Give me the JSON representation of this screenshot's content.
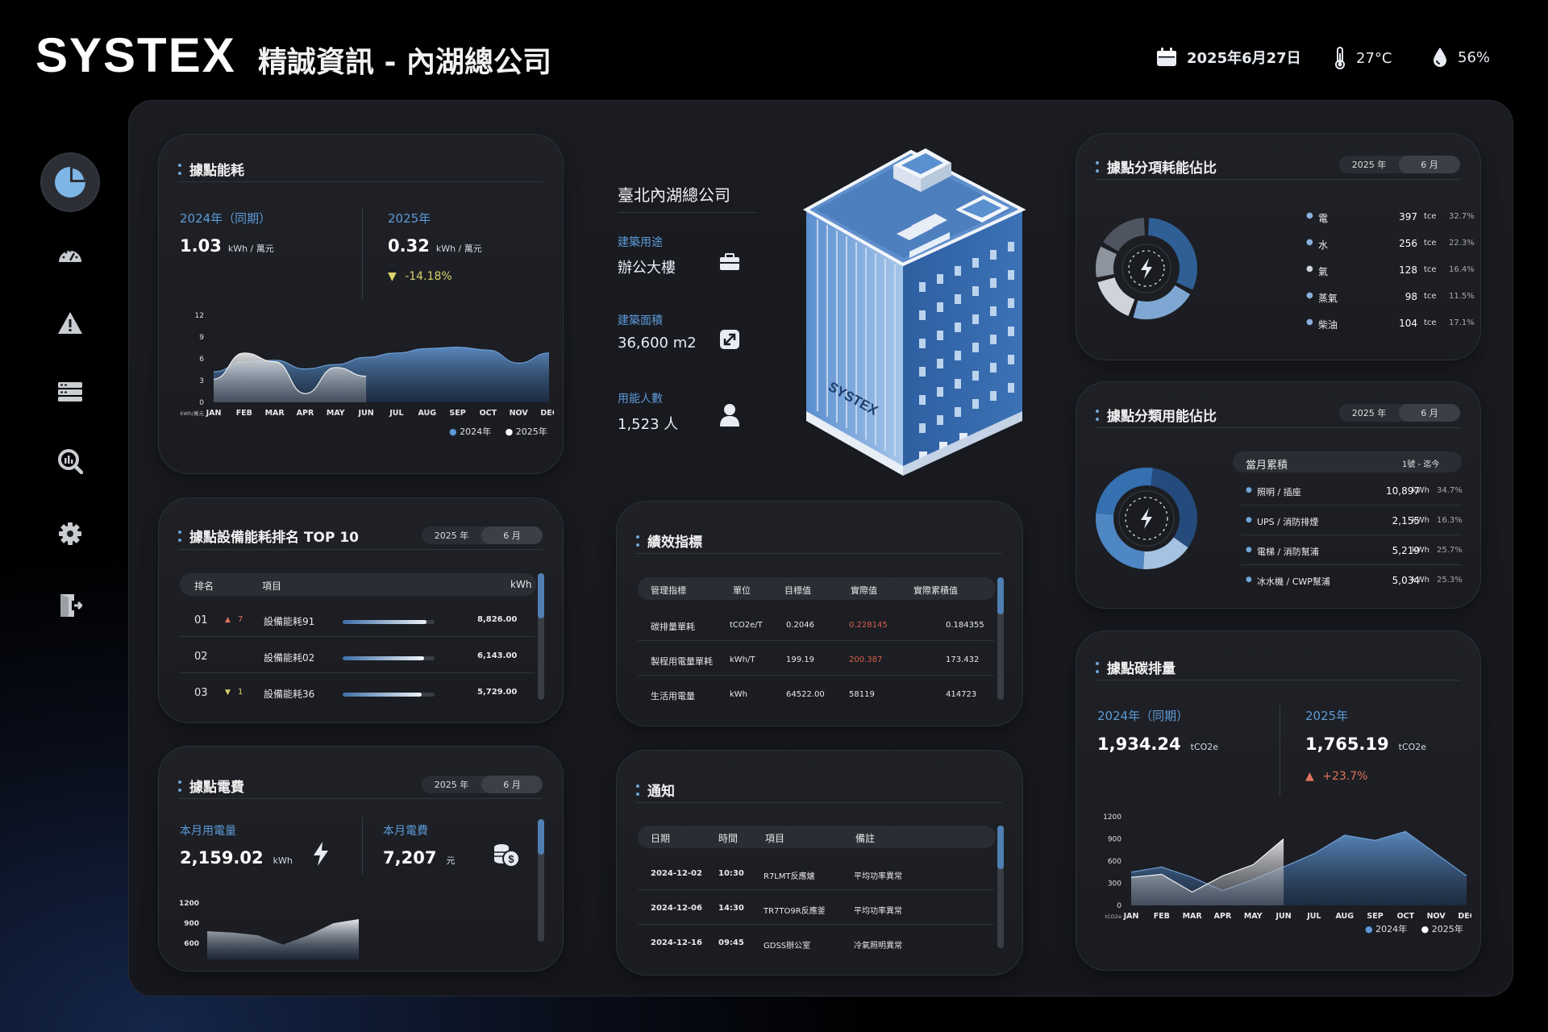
{
  "header": {
    "brand": "SYSTEX",
    "site_title": "精誠資訊 - 內湖總公司",
    "date": "2025年6月27日",
    "temp": "27°C",
    "humidity": "56%"
  },
  "colors": {
    "accent": "#5d9ad6",
    "up_arrow": "#e0735b",
    "down_arrow": "#d9d36a",
    "highlight_red": "#d8604a"
  },
  "sidebar": [
    {
      "icon": "pie-chart-icon",
      "active": true
    },
    {
      "icon": "gauge-icon"
    },
    {
      "icon": "warning-icon"
    },
    {
      "icon": "server-icon"
    },
    {
      "icon": "search-chart-icon"
    },
    {
      "icon": "gear-icon"
    },
    {
      "icon": "logout-icon"
    }
  ],
  "energy": {
    "title": "據點能耗",
    "prev_label": "2024年（同期）",
    "prev_value": "1.03",
    "prev_unit": "kWh / 萬元",
    "cur_label": "2025年",
    "cur_value": "0.32",
    "cur_unit": "kWh / 萬元",
    "change": "-14.18%",
    "y_unit": "kWh/萬元",
    "legend_prev": "2024年",
    "legend_cur": "2025年"
  },
  "energy_chart": {
    "type": "area",
    "x": [
      "JAN",
      "FEB",
      "MAR",
      "APR",
      "MAY",
      "JUN",
      "JUL",
      "AUG",
      "SEP",
      "OCT",
      "NOV",
      "DEC"
    ],
    "ylim": [
      0,
      12
    ],
    "yticks": [
      "12",
      "9",
      "6",
      "3",
      "0"
    ],
    "series": [
      {
        "name": "2024年",
        "values": [
          4.2,
          5.6,
          5.8,
          4.6,
          5.2,
          6.2,
          6.8,
          7.4,
          7.6,
          7.2,
          5.4,
          6.8
        ]
      },
      {
        "name": "2025年",
        "values": [
          3.2,
          6.8,
          5.6,
          1.2,
          4.8,
          3.6
        ]
      }
    ]
  },
  "ranking": {
    "title": "據點設備能耗排名 TOP 10",
    "year": "2025 年",
    "month": "6 月",
    "headers": [
      "排名",
      "項目",
      "kWh"
    ],
    "rows": [
      {
        "rank": "01",
        "trend": "up",
        "delta": "7",
        "item": "設備能耗91",
        "value": "8,826.00",
        "fill": 0.98
      },
      {
        "rank": "02",
        "trend": "",
        "delta": "",
        "item": "設備能耗02",
        "value": "6,143.00",
        "fill": 0.95
      },
      {
        "rank": "03",
        "trend": "down",
        "delta": "1",
        "item": "設備能耗36",
        "value": "5,729.00",
        "fill": 0.92
      }
    ]
  },
  "electricity": {
    "title": "據點電費",
    "year": "2025 年",
    "month": "6 月",
    "usage_label": "本月用電量",
    "usage_value": "2,159.02",
    "usage_unit": "kWh",
    "fee_label": "本月電費",
    "fee_value": "7,207",
    "fee_unit": "元"
  },
  "electricity_chart": {
    "type": "area",
    "yticks": [
      "1200",
      "900",
      "600"
    ],
    "ylim": [
      600,
      1200
    ],
    "values": [
      780,
      760,
      720,
      580,
      720,
      900,
      960
    ]
  },
  "building": {
    "name": "臺北內湖總公司",
    "use_label": "建築用途",
    "use_value": "辦公大樓",
    "area_label": "建築面積",
    "area_value": "36,600  m2",
    "people_label": "用能人數",
    "people_value": "1,523   人",
    "sign": "SYSTEX"
  },
  "kpi": {
    "title": "績效指標",
    "headers": [
      "管理指標",
      "單位",
      "目標值",
      "實際值",
      "實際累積值"
    ],
    "rows": [
      {
        "name": "碳排量單耗",
        "unit": "tCO2e/T",
        "target": "0.2046",
        "actual": "0.228145",
        "cum": "0.184355",
        "alert": true
      },
      {
        "name": "製程用電量單耗",
        "unit": "kWh/T",
        "target": "199.19",
        "actual": "200.387",
        "cum": "173.432",
        "alert": true
      },
      {
        "name": "生活用電量",
        "unit": "kWh",
        "target": "64522.00",
        "actual": "58119",
        "cum": "414723",
        "alert": false
      }
    ]
  },
  "notice": {
    "title": "通知",
    "headers": [
      "日期",
      "時間",
      "項目",
      "備註"
    ],
    "rows": [
      {
        "date": "2024-12-02",
        "time": "10:30",
        "item": "R7LMT反應爐",
        "note": "平均功率異常"
      },
      {
        "date": "2024-12-06",
        "time": "14:30",
        "item": "TR7TO9R反應釜",
        "note": "平均功率異常"
      },
      {
        "date": "2024-12-16",
        "time": "09:45",
        "item": "GDSS辦公室",
        "note": "冷氣照明異常"
      }
    ]
  },
  "share": {
    "title": "據點分項耗能佔比",
    "year": "2025 年",
    "month": "6 月",
    "items": [
      {
        "name": "電",
        "value": "397",
        "unit": "tce",
        "pct": "32.7%",
        "frac": 0.327,
        "color": "#2f5f95"
      },
      {
        "name": "水",
        "value": "256",
        "unit": "tce",
        "pct": "22.3%",
        "frac": 0.223,
        "color": "#7ea6d2"
      },
      {
        "name": "氣",
        "value": "128",
        "unit": "tce",
        "pct": "16.4%",
        "frac": 0.164,
        "color": "#d0d4da"
      },
      {
        "name": "蒸氣",
        "value": "98",
        "unit": "tce",
        "pct": "11.5%",
        "frac": 0.115,
        "color": "#8d949e"
      },
      {
        "name": "柴油",
        "value": "104",
        "unit": "tce",
        "pct": "17.1%",
        "frac": 0.171,
        "color": "#4e5560"
      }
    ]
  },
  "category": {
    "title": "據點分類用能佔比",
    "year": "2025 年",
    "month": "6 月",
    "sub_title": "當月累積",
    "sub_range": "1號 - 迄今",
    "items": [
      {
        "name": "照明 / 插座",
        "value": "10,897",
        "unit": "kWh",
        "pct": "34.7%",
        "frac": 0.347,
        "color": "#244b7c"
      },
      {
        "name": "UPS / 消防排煙",
        "value": "2,155",
        "unit": "kWh",
        "pct": "16.3%",
        "frac": 0.163,
        "color": "#a5c2e2"
      },
      {
        "name": "電梯 / 消防幫浦",
        "value": "5,219",
        "unit": "kWh",
        "pct": "25.7%",
        "frac": 0.257,
        "color": "#4f86c4"
      },
      {
        "name": "冰水機 / CWP幫浦",
        "value": "5,034",
        "unit": "kWh",
        "pct": "25.3%",
        "frac": 0.253,
        "color": "#3570b0"
      }
    ]
  },
  "carbon": {
    "title": "據點碳排量",
    "prev_label": "2024年（同期）",
    "prev_value": "1,934.24",
    "prev_unit": "tCO2e",
    "cur_label": "2025年",
    "cur_value": "1,765.19",
    "cur_unit": "tCO2e",
    "change": "+23.7%",
    "y_unit": "tCO2e",
    "legend_prev": "2024年",
    "legend_cur": "2025年"
  },
  "carbon_chart": {
    "type": "area",
    "x": [
      "JAN",
      "FEB",
      "MAR",
      "APR",
      "MAY",
      "JUN",
      "JUL",
      "AUG",
      "SEP",
      "OCT",
      "NOV",
      "DEC"
    ],
    "ylim": [
      0,
      1200
    ],
    "yticks": [
      "1200",
      "900",
      "600",
      "300",
      "0"
    ],
    "series": [
      {
        "name": "2024年",
        "values": [
          450,
          520,
          380,
          200,
          350,
          520,
          700,
          950,
          880,
          1000,
          700,
          400
        ]
      },
      {
        "name": "2025年",
        "values": [
          380,
          420,
          180,
          400,
          550,
          900
        ]
      }
    ]
  }
}
